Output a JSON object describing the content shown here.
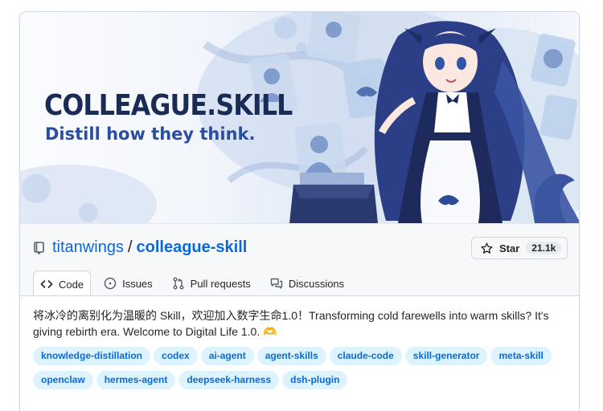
{
  "banner": {
    "title": "COLLEAGUE.SKILL",
    "subtitle": "Distill how they think."
  },
  "repo": {
    "owner": "titanwings",
    "separator": "/",
    "name": "colleague-skill"
  },
  "star": {
    "label": "Star",
    "count": "21.1k"
  },
  "tabs": [
    {
      "label": "Code",
      "icon": "code-icon"
    },
    {
      "label": "Issues",
      "icon": "issue-icon"
    },
    {
      "label": "Pull requests",
      "icon": "pull-request-icon"
    },
    {
      "label": "Discussions",
      "icon": "discussions-icon"
    }
  ],
  "description": "将冰冷的离别化为温暖的 Skill，欢迎加入数字生命1.0！Transforming cold farewells into warm skills? It's giving rebirth era. Welcome to Digital Life 1.0. 🫶",
  "topics": [
    "knowledge-distillation",
    "codex",
    "ai-agent",
    "agent-skills",
    "claude-code",
    "skill-generator",
    "meta-skill",
    "openclaw",
    "hermes-agent",
    "deepseek-harness",
    "dsh-plugin"
  ],
  "colors": {
    "link": "#0969da",
    "topic_bg": "#ddf4ff",
    "banner_title": "#1a2b56",
    "banner_subtitle": "#2b4fa0"
  }
}
